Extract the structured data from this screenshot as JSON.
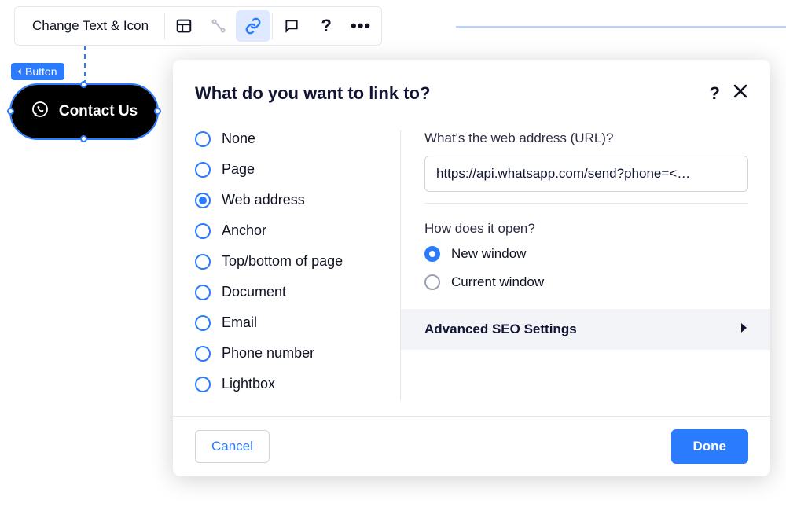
{
  "toolbar": {
    "label": "Change Text & Icon"
  },
  "button_tag": {
    "label": "Button"
  },
  "canvas_button": {
    "label": "Contact Us"
  },
  "dialog": {
    "title": "What do you want to link to?",
    "help_symbol": "?",
    "link_types": [
      {
        "label": "None",
        "selected": false
      },
      {
        "label": "Page",
        "selected": false
      },
      {
        "label": "Web address",
        "selected": true
      },
      {
        "label": "Anchor",
        "selected": false
      },
      {
        "label": "Top/bottom of page",
        "selected": false
      },
      {
        "label": "Document",
        "selected": false
      },
      {
        "label": "Email",
        "selected": false
      },
      {
        "label": "Phone number",
        "selected": false
      },
      {
        "label": "Lightbox",
        "selected": false
      }
    ],
    "url_label": "What's the web address (URL)?",
    "url_value": "https://api.whatsapp.com/send?phone=<…",
    "open_label": "How does it open?",
    "open_options": [
      {
        "label": "New window",
        "selected": true
      },
      {
        "label": "Current window",
        "selected": false
      }
    ],
    "seo_label": "Advanced SEO Settings",
    "footer": {
      "cancel": "Cancel",
      "done": "Done"
    }
  },
  "colors": {
    "accent": "#2b7bff"
  }
}
